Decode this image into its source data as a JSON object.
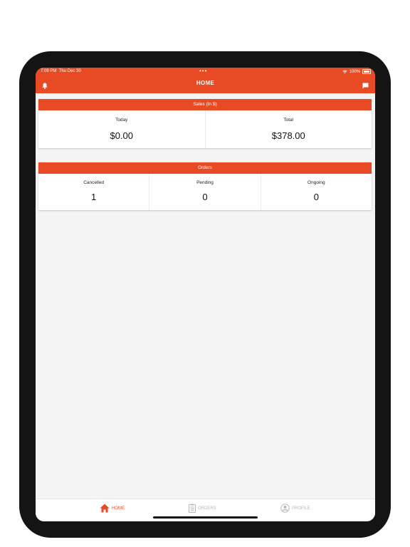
{
  "status_bar": {
    "time": "7:09 PM",
    "date": "Thu Dec 30",
    "battery": "100%"
  },
  "header": {
    "title": "HOME",
    "left_icon": "bell-icon",
    "right_icon": "message-icon"
  },
  "sales": {
    "title": "Sales (In $)",
    "items": [
      {
        "label": "Today",
        "value": "$0.00"
      },
      {
        "label": "Total",
        "value": "$378.00"
      }
    ]
  },
  "orders": {
    "title": "Orders",
    "items": [
      {
        "label": "Cancelled",
        "value": "1"
      },
      {
        "label": "Pending",
        "value": "0"
      },
      {
        "label": "Ongoing",
        "value": "0"
      }
    ]
  },
  "tabbar": {
    "items": [
      {
        "label": "HOME",
        "icon": "home-icon",
        "active": true
      },
      {
        "label": "ORDERS",
        "icon": "clipboard-icon",
        "active": false
      },
      {
        "label": "PROFILE",
        "icon": "user-circle-icon",
        "active": false
      }
    ]
  },
  "colors": {
    "accent": "#e84b23",
    "background": "#f4f4f4",
    "inactive": "#b8b8b8"
  }
}
